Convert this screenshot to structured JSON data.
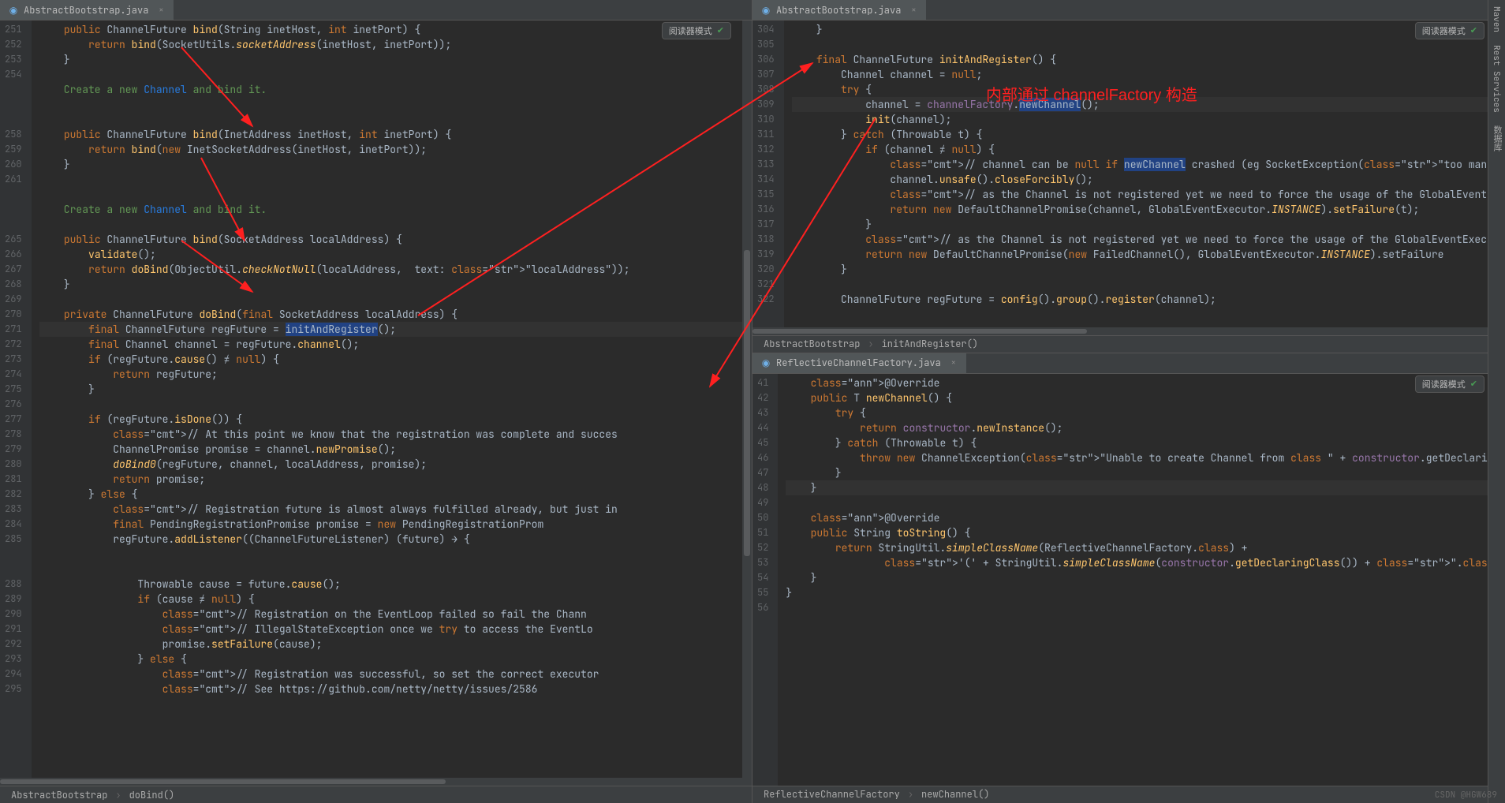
{
  "watermark": "CSDN @HGW689",
  "annotation_text": "内部通过 channelFactory 构造",
  "left": {
    "tab": "AbstractBootstrap.java",
    "reader": "阅读器模式",
    "crumb1": "AbstractBootstrap",
    "crumb2": "doBind()",
    "lines_start": 251,
    "lines": [
      "    public ChannelFuture bind(String inetHost, int inetPort) {",
      "        return bind(SocketUtils.socketAddress(inetHost, inetPort));",
      "    }",
      "",
      "    Create a new Channel and bind it.",
      "",
      "",
      "    public ChannelFuture bind(InetAddress inetHost, int inetPort) {",
      "        return bind(new InetSocketAddress(inetHost, inetPort));",
      "    }",
      "",
      "",
      "    Create a new Channel and bind it.",
      "",
      "    public ChannelFuture bind(SocketAddress localAddress) {",
      "        validate();",
      "        return doBind(ObjectUtil.checkNotNull(localAddress,  text: \"localAddress\"));",
      "    }",
      "",
      "    private ChannelFuture doBind(final SocketAddress localAddress) {",
      "        final ChannelFuture regFuture = initAndRegister();",
      "        final Channel channel = regFuture.channel();",
      "        if (regFuture.cause() ≠ null) {",
      "            return regFuture;",
      "        }",
      "",
      "        if (regFuture.isDone()) {",
      "            // At this point we know that the registration was complete and succes",
      "            ChannelPromise promise = channel.newPromise();",
      "            doBind0(regFuture, channel, localAddress, promise);",
      "            return promise;",
      "        } else {",
      "            // Registration future is almost always fulfilled already, but just in",
      "            final PendingRegistrationPromise promise = new PendingRegistrationProm",
      "            regFuture.addListener((ChannelFutureListener) (future) → {",
      "",
      "",
      "                Throwable cause = future.cause();",
      "                if (cause ≠ null) {",
      "                    // Registration on the EventLoop failed so fail the Chann",
      "                    // IllegalStateException once we try to access the EventLo",
      "                    promise.setFailure(cause);",
      "                } else {",
      "                    // Registration was successful, so set the correct executor",
      "                    // See https://github.com/netty/netty/issues/2586"
    ]
  },
  "rtop": {
    "tab": "AbstractBootstrap.java",
    "reader": "阅读器模式",
    "crumb1": "AbstractBootstrap",
    "crumb2": "initAndRegister()",
    "lines_start": 304,
    "lines": [
      "    }",
      "",
      "    final ChannelFuture initAndRegister() {",
      "        Channel channel = null;",
      "        try {",
      "            channel = channelFactory.newChannel();",
      "            init(channel);",
      "        } catch (Throwable t) {",
      "            if (channel ≠ null) {",
      "                // channel can be null if newChannel crashed (eg SocketException(\"too many open files\"))",
      "                channel.unsafe().closeForcibly();",
      "                // as the Channel is not registered yet we need to force the usage of the GlobalEventExec…",
      "                return new DefaultChannelPromise(channel, GlobalEventExecutor.INSTANCE).setFailure(t);",
      "            }",
      "            // as the Channel is not registered yet we need to force the usage of the GlobalEventExecutor",
      "            return new DefaultChannelPromise(new FailedChannel(), GlobalEventExecutor.INSTANCE).setFailure",
      "        }",
      "",
      "        ChannelFuture regFuture = config().group().register(channel);"
    ]
  },
  "rbot": {
    "tab": "ReflectiveChannelFactory.java",
    "reader": "阅读器模式",
    "crumb1": "ReflectiveChannelFactory",
    "crumb2": "newChannel()",
    "lines_start": 41,
    "lines": [
      "    @Override",
      "    public T newChannel() {",
      "        try {",
      "            return constructor.newInstance();",
      "        } catch (Throwable t) {",
      "            throw new ChannelException(\"Unable to create Channel from class \" + constructor.getDeclaringClass",
      "        }",
      "    }",
      "",
      "    @Override",
      "    public String toString() {",
      "        return StringUtil.simpleClassName(ReflectiveChannelFactory.class) +",
      "                '(' + StringUtil.simpleClassName(constructor.getDeclaringClass()) + \".class)\";",
      "    }",
      "}",
      ""
    ]
  },
  "sidetools": {
    "maven": "Maven",
    "rest": "Rest Services",
    "db": "数据库"
  }
}
